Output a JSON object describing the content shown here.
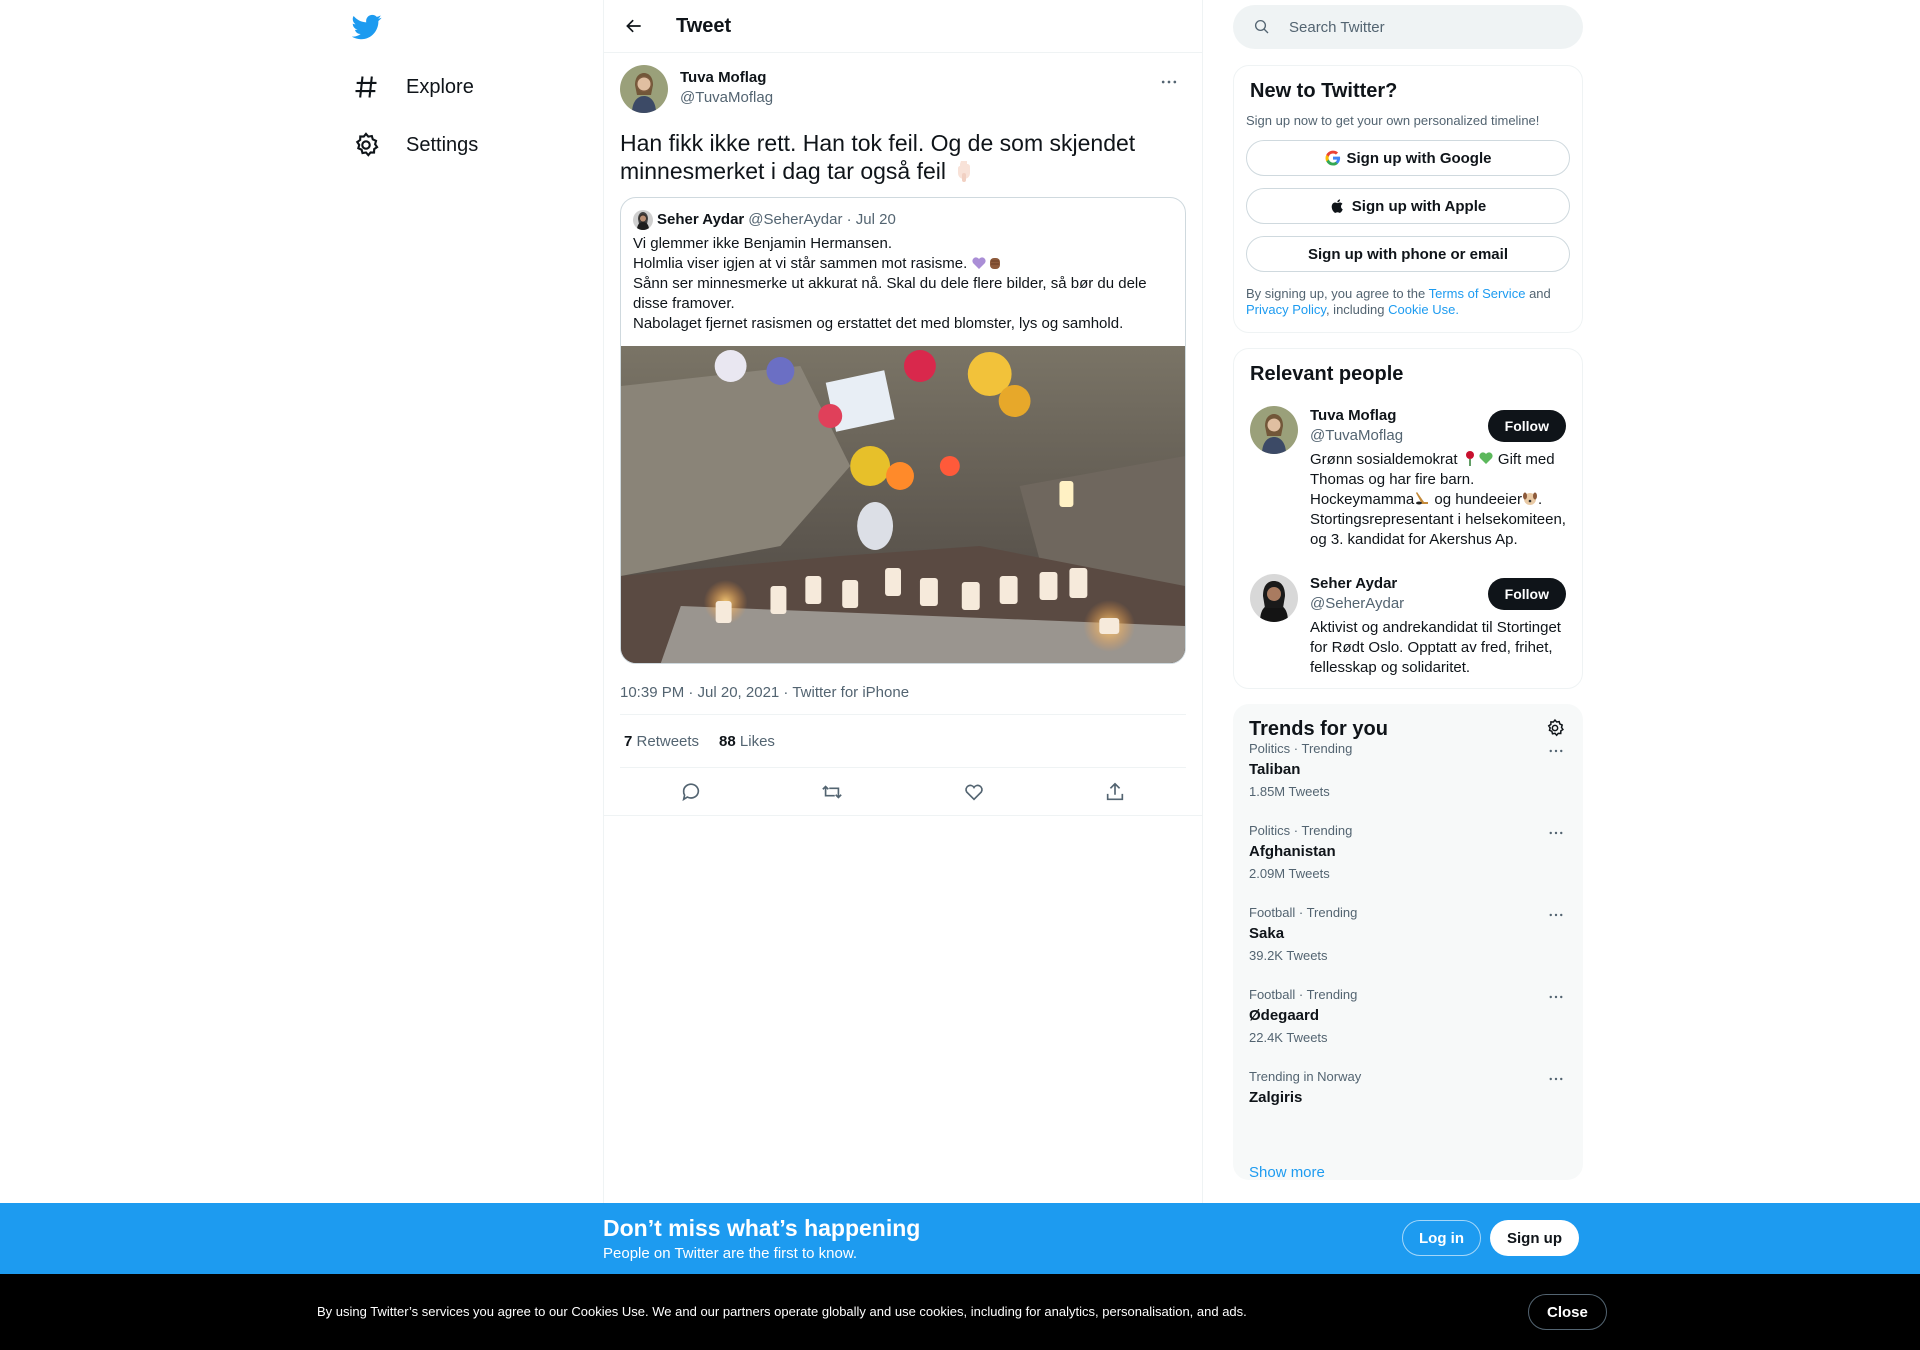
{
  "nav": {
    "items": [
      {
        "label": "Explore",
        "icon": "hashtag-icon"
      },
      {
        "label": "Settings",
        "icon": "gear-icon"
      }
    ]
  },
  "header": {
    "title": "Tweet"
  },
  "tweet": {
    "author_name": "Tuva Moflag",
    "author_handle": "@TuvaMoflag",
    "text": "Han fikk ikke rett. Han tok feil. Og de som skjendet minnesmerket i dag tar også feil",
    "emoji": "pointing-down-hand",
    "quote": {
      "author_name": "Seher Aydar",
      "author_handle": "@SeherAydar",
      "date": "Jul 20",
      "lines": [
        "Vi glemmer ikke Benjamin Hermansen.",
        "Holmlia viser igjen at vi står sammen mot rasisme.",
        "Sånn ser minnesmerke ut akkurat nå. Skal du dele flere bilder, så bør du dele disse framover.",
        "Nabolaget fjernet rasismen og erstattet det med blomster, lys og samhold."
      ],
      "image_alt": "memorial-with-flowers-and-candles"
    },
    "meta": "10:39 PM · Jul 20, 2021 · Twitter for iPhone",
    "retweets": "7",
    "retweets_label": "Retweets",
    "likes": "88",
    "likes_label": "Likes"
  },
  "search": {
    "placeholder": "Search Twitter"
  },
  "signup_card": {
    "title": "New to Twitter?",
    "subtitle": "Sign up now to get your own personalized timeline!",
    "google": "Sign up with Google",
    "apple": "Sign up with Apple",
    "email": "Sign up with phone or email",
    "legal_prefix": "By signing up, you agree to the",
    "terms": "Terms of Service",
    "and": "and",
    "privacy": "Privacy Policy",
    "including": ", including",
    "cookie": "Cookie Use."
  },
  "people": {
    "title": "Relevant people",
    "items": [
      {
        "name": "Tuva Moflag",
        "handle": "@TuvaMoflag",
        "bio_1": "Grønn sosialdemokrat",
        "bio_2": "Gift med Thomas og har fire barn. Hockeymamma",
        "bio_3": "og hundeeier",
        "bio_4": ". Stortingsrepresentant i helsekomiteen, og 3. kandidat for Akershus Ap.",
        "follow": "Follow"
      },
      {
        "name": "Seher Aydar",
        "handle": "@SeherAydar",
        "bio": "Aktivist og andrekandidat til Stortinget for Rødt Oslo. Opptatt av fred, frihet, fellesskap og solidaritet.",
        "follow": "Follow"
      }
    ]
  },
  "trends": {
    "title": "Trends for you",
    "items": [
      {
        "category": "Politics · Trending",
        "name": "Taliban",
        "count": "1.85M Tweets"
      },
      {
        "category": "Politics · Trending",
        "name": "Afghanistan",
        "count": "2.09M Tweets"
      },
      {
        "category": "Football · Trending",
        "name": "Saka",
        "count": "39.2K Tweets"
      },
      {
        "category": "Football · Trending",
        "name": "Ødegaard",
        "count": "22.4K Tweets"
      },
      {
        "category": "Trending in Norway",
        "name": "Zalgiris",
        "count": ""
      }
    ],
    "show_more": "Show more"
  },
  "banner": {
    "title": "Don’t miss what’s happening",
    "subtitle": "People on Twitter are the first to know.",
    "login": "Log in",
    "signup": "Sign up"
  },
  "cookie_bar": {
    "text": "By using Twitter’s services you agree to our Cookies Use. We and our partners operate globally and use cookies, including for analytics, personalisation, and ads.",
    "close": "Close"
  },
  "colors": {
    "accent": "#1d9bf0",
    "text": "#0f1419",
    "muted": "#536471"
  }
}
